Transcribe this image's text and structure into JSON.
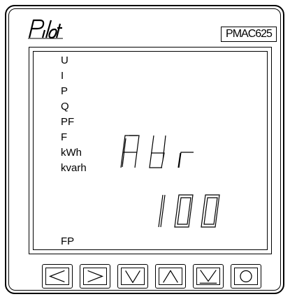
{
  "device": {
    "brand": "Pilot",
    "model": "PMAC625"
  },
  "lcd": {
    "indicators": [
      "U",
      "I",
      "P",
      "Q",
      "PF",
      "F",
      "kWh",
      "kvarh"
    ],
    "fp_label": "FP",
    "line1": "Adr",
    "line2": "100"
  },
  "buttons": [
    {
      "name": "left-button",
      "icon": "arrow-left-icon"
    },
    {
      "name": "right-button",
      "icon": "arrow-right-icon"
    },
    {
      "name": "down-button",
      "icon": "arrow-down-icon"
    },
    {
      "name": "up-button",
      "icon": "arrow-up-icon"
    },
    {
      "name": "enter-button",
      "icon": "enter-arrow-icon"
    },
    {
      "name": "menu-button",
      "icon": "circle-icon"
    }
  ]
}
